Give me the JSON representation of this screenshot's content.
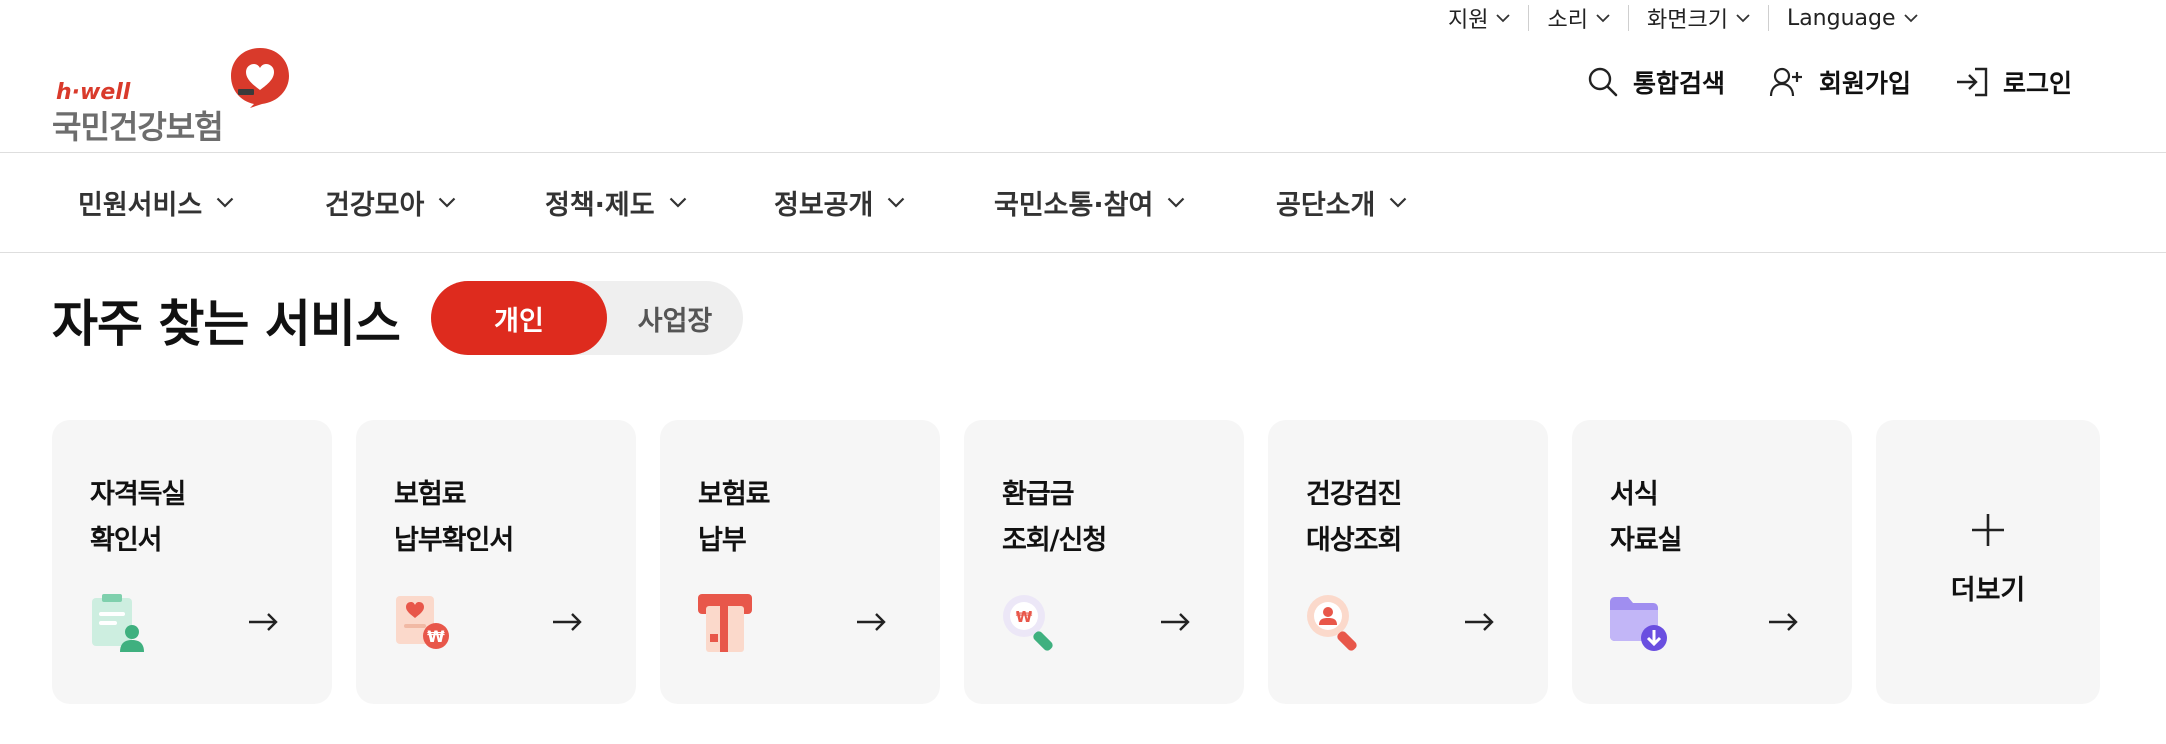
{
  "utility": {
    "items": [
      {
        "label": "지원"
      },
      {
        "label": "소리"
      },
      {
        "label": "화면크기"
      },
      {
        "label": "Language"
      }
    ]
  },
  "header": {
    "logo": {
      "brand": "h·well",
      "name": "국민건강보험"
    },
    "actions": {
      "search": "통합검색",
      "signup": "회원가입",
      "login": "로그인"
    }
  },
  "gnb": {
    "items": [
      {
        "label": "민원서비스"
      },
      {
        "label": "건강모아"
      },
      {
        "label": "정책·제도"
      },
      {
        "label": "정보공개"
      },
      {
        "label": "국민소통·참여"
      },
      {
        "label": "공단소개"
      }
    ]
  },
  "services": {
    "title": "자주 찾는 서비스",
    "toggle": {
      "active": "개인",
      "inactive": "사업장"
    },
    "cards": [
      {
        "title": "자격득실\n확인서",
        "icon": "qualification-document-icon"
      },
      {
        "title": "보험료\n납부확인서",
        "icon": "payment-certificate-icon"
      },
      {
        "title": "보험료\n납부",
        "icon": "card-payment-icon"
      },
      {
        "title": "환급금\n조회/신청",
        "icon": "refund-search-icon"
      },
      {
        "title": "건강검진\n대상조회",
        "icon": "checkup-search-icon"
      },
      {
        "title": "서식\n자료실",
        "icon": "download-folder-icon"
      }
    ],
    "more": "더보기"
  },
  "colors": {
    "brand_red": "#de2b1e",
    "card_bg": "#f6f6f6",
    "toggle_bg": "#efefef"
  }
}
